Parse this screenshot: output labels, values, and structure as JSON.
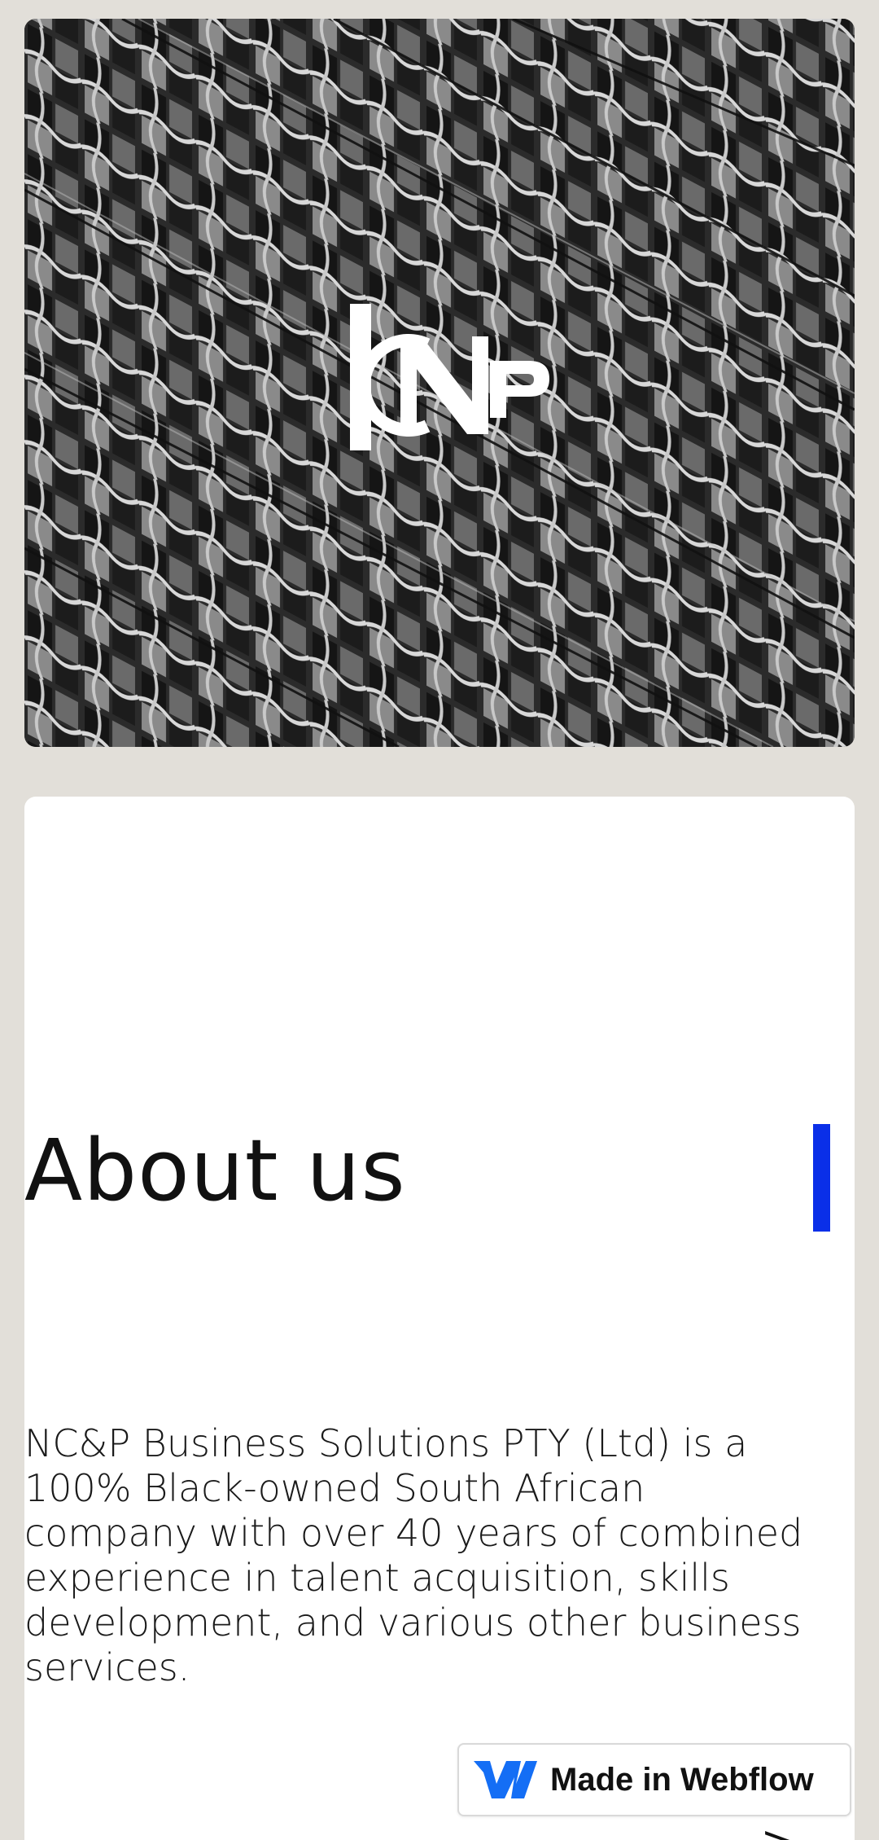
{
  "hero": {
    "logo_letters": "NCP"
  },
  "about": {
    "title": "About us",
    "body": "NC&P Business Solutions PTY (Ltd) is a 100% Black-owned South African company with over 40 years of combined experience in talent acquisition, skills development, and various other business services.",
    "accent_color": "#0a2fe8"
  },
  "badge": {
    "label": "Made in Webflow",
    "icon": "webflow-icon",
    "color": "#146ef5"
  },
  "nav": {
    "next_glyph": ">"
  },
  "colors": {
    "page_background": "#e2dfd9",
    "card_background": "#ffffff",
    "text": "#111111"
  }
}
